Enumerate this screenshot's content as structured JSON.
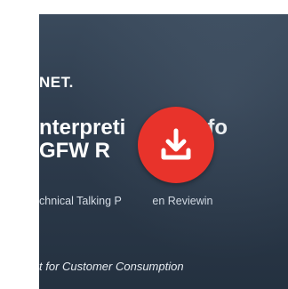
{
  "document": {
    "brand": "NET.",
    "title_line1": "nterpreti        AP fo",
    "title_line2": "GFW R",
    "subtitle": "chnical Talking P          en Reviewin",
    "footer": "t for Customer Consumption"
  },
  "download_button": {
    "icon": "download-icon",
    "color": "#e8332b"
  }
}
